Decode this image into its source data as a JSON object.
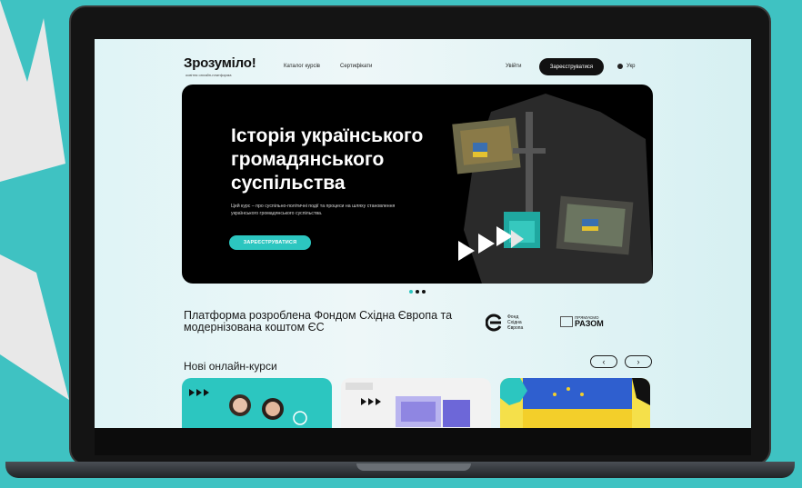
{
  "nav": {
    "logo": "Зрозуміло!",
    "logo_sub": "освітня онлайн-платформа",
    "links": [
      "Каталог курсів",
      "Сертифікати"
    ],
    "login": "Увійти",
    "register": "Зареєструватися",
    "lang": "Укр"
  },
  "hero": {
    "title_lines": [
      "Історія українського",
      "громадянського",
      "суспільства"
    ],
    "description": "Цей курс – про суспільно-політичні події та процеси на шляху становлення українського громадянського суспільства.",
    "button": "ЗАРЕЄСТРУВАТИСЯ"
  },
  "carousel": {
    "total": 3,
    "active": 1
  },
  "partners": {
    "text": "Платформа розроблена Фондом Східна Європа та модернізована коштом ЄС",
    "fond_lines": [
      "Фонд",
      "Східна",
      "Європа"
    ],
    "razom_small": "ПРЯМУЄМО",
    "razom_big": "РАЗОМ"
  },
  "courses": {
    "title": "Нові онлайн-курси",
    "prev_icon": "chevron-left-icon",
    "next_icon": "chevron-right-icon"
  },
  "colors": {
    "accent": "#2cc6c0",
    "background": "#3fc2c2"
  }
}
